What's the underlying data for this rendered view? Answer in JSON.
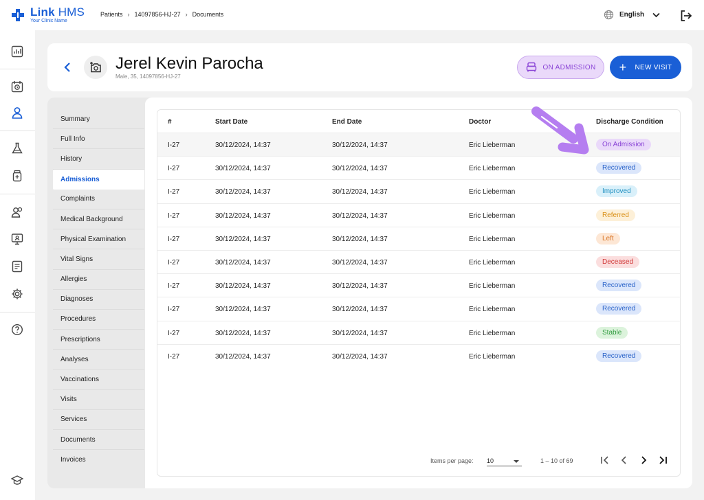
{
  "app": {
    "name_bold": "Link",
    "name_light": "HMS",
    "subtitle": "Your Clinic Name"
  },
  "breadcrumb": [
    "Patients",
    "14097856-HJ-27",
    "Documents"
  ],
  "language": {
    "label": "English"
  },
  "patient": {
    "name": "Jerel Kevin Parocha",
    "meta": "Male, 35, 14097856-HJ-27"
  },
  "actions": {
    "admission_label": "ON ADMISSION",
    "new_visit_label": "NEW VISIT"
  },
  "submenu": [
    "Summary",
    "Full Info",
    "History",
    "Admissions",
    "Complaints",
    "Medical Background",
    "Physical Examination",
    "Vital Signs",
    "Allergies",
    "Diagnoses",
    "Procedures",
    "Prescriptions",
    "Analyses",
    "Vaccinations",
    "Visits",
    "Services",
    "Documents",
    "Invoices"
  ],
  "submenu_active": "Admissions",
  "table": {
    "headers": [
      "#",
      "Start Date",
      "End Date",
      "Doctor",
      "Discharge Condition"
    ],
    "rows": [
      {
        "id": "I-27",
        "start": "30/12/2024, 14:37",
        "end": "30/12/2024, 14:37",
        "doctor": "Eric Lieberman",
        "condition": "On Admission"
      },
      {
        "id": "I-27",
        "start": "30/12/2024, 14:37",
        "end": "30/12/2024, 14:37",
        "doctor": "Eric Lieberman",
        "condition": "Recovered"
      },
      {
        "id": "I-27",
        "start": "30/12/2024, 14:37",
        "end": "30/12/2024, 14:37",
        "doctor": "Eric Lieberman",
        "condition": "Improved"
      },
      {
        "id": "I-27",
        "start": "30/12/2024, 14:37",
        "end": "30/12/2024, 14:37",
        "doctor": "Eric Lieberman",
        "condition": "Referred"
      },
      {
        "id": "I-27",
        "start": "30/12/2024, 14:37",
        "end": "30/12/2024, 14:37",
        "doctor": "Eric Lieberman",
        "condition": "Left"
      },
      {
        "id": "I-27",
        "start": "30/12/2024, 14:37",
        "end": "30/12/2024, 14:37",
        "doctor": "Eric Lieberman",
        "condition": "Deceased"
      },
      {
        "id": "I-27",
        "start": "30/12/2024, 14:37",
        "end": "30/12/2024, 14:37",
        "doctor": "Eric Lieberman",
        "condition": "Recovered"
      },
      {
        "id": "I-27",
        "start": "30/12/2024, 14:37",
        "end": "30/12/2024, 14:37",
        "doctor": "Eric Lieberman",
        "condition": "Recovered"
      },
      {
        "id": "I-27",
        "start": "30/12/2024, 14:37",
        "end": "30/12/2024, 14:37",
        "doctor": "Eric Lieberman",
        "condition": "Stable"
      },
      {
        "id": "I-27",
        "start": "30/12/2024, 14:37",
        "end": "30/12/2024, 14:37",
        "doctor": "Eric Lieberman",
        "condition": "Recovered"
      }
    ]
  },
  "badge_colors": {
    "On Admission": {
      "bg": "#ead9fa",
      "fg": "#8a44d6"
    },
    "Recovered": {
      "bg": "#dbe6fb",
      "fg": "#2a63c9"
    },
    "Improved": {
      "bg": "#d9f0fa",
      "fg": "#1f8fc0"
    },
    "Referred": {
      "bg": "#fdf0d8",
      "fg": "#d99018"
    },
    "Left": {
      "bg": "#fde7d5",
      "fg": "#d9772a"
    },
    "Deceased": {
      "bg": "#fbdede",
      "fg": "#d03636"
    },
    "Stable": {
      "bg": "#dcf3dc",
      "fg": "#2e9a3c"
    }
  },
  "pagination": {
    "items_per_page_label": "Items per page:",
    "items_per_page_value": "10",
    "range_text": "1 – 10 of 69"
  },
  "colors": {
    "accent": "#1a5fd6",
    "annotation_arrow": "#b57ef0"
  }
}
